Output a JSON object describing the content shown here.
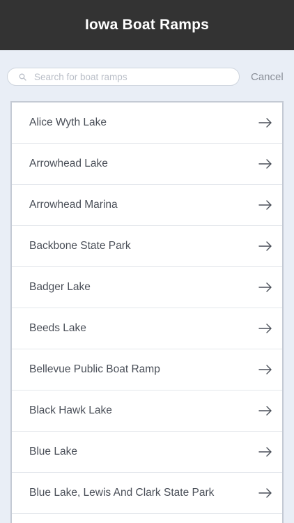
{
  "header": {
    "title": "Iowa Boat Ramps"
  },
  "search": {
    "placeholder": "Search for boat ramps",
    "value": "",
    "cancel_label": "Cancel",
    "icon": "search-icon"
  },
  "list": {
    "items": [
      {
        "label": "Alice Wyth Lake",
        "icon": "arrow-right-icon"
      },
      {
        "label": "Arrowhead Lake",
        "icon": "arrow-right-icon"
      },
      {
        "label": "Arrowhead Marina",
        "icon": "arrow-right-icon"
      },
      {
        "label": "Backbone State Park",
        "icon": "arrow-right-icon"
      },
      {
        "label": "Badger Lake",
        "icon": "arrow-right-icon"
      },
      {
        "label": "Beeds Lake",
        "icon": "arrow-right-icon"
      },
      {
        "label": "Bellevue Public Boat Ramp",
        "icon": "arrow-right-icon"
      },
      {
        "label": "Black Hawk Lake",
        "icon": "arrow-right-icon"
      },
      {
        "label": "Blue Lake",
        "icon": "arrow-right-icon"
      },
      {
        "label": "Blue Lake, Lewis And Clark State Park",
        "icon": "arrow-right-icon"
      }
    ]
  },
  "colors": {
    "header_bg": "#333333",
    "page_bg": "#e9eef6",
    "text": "#4a4f58",
    "muted": "#8a8f98"
  }
}
